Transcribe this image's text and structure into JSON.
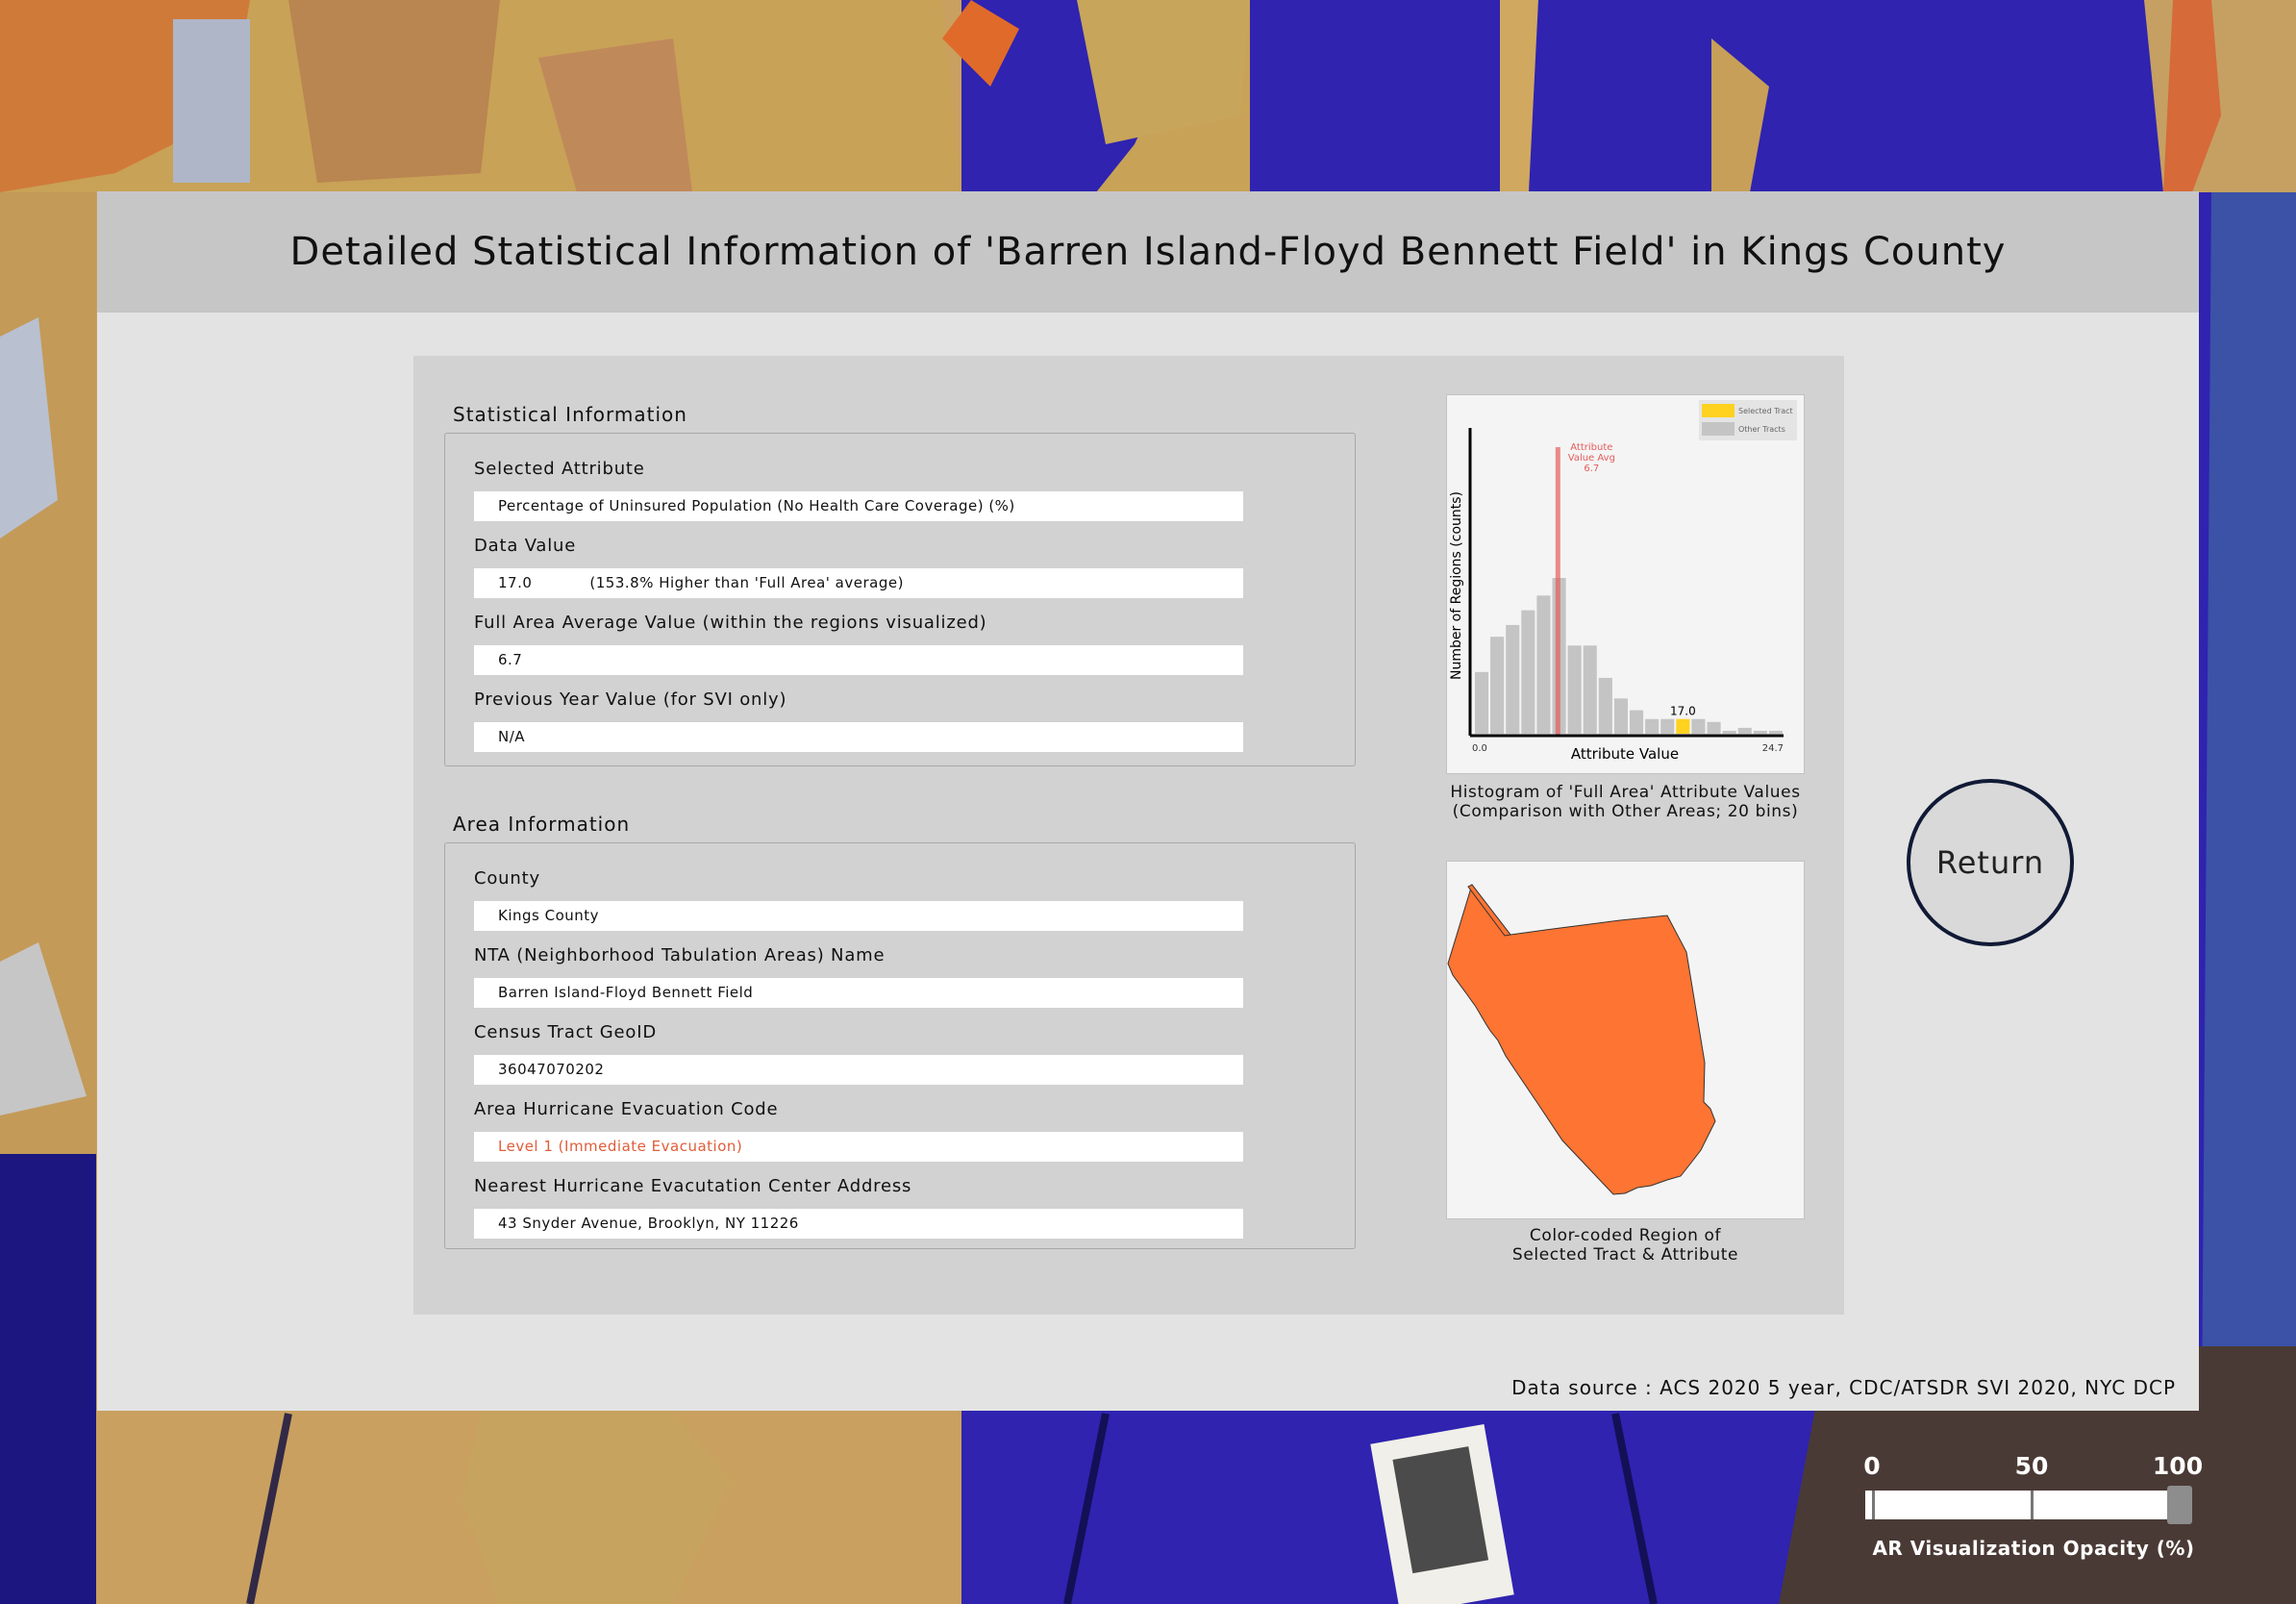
{
  "title": "Detailed Statistical Information of 'Barren Island-Floyd Bennett Field' in Kings County",
  "statistical": {
    "heading": "Statistical Information",
    "selected_attribute_label": "Selected Attribute",
    "selected_attribute_value": "Percentage of Uninsured Population (No Health Care Coverage) (%)",
    "data_value_label": "Data Value",
    "data_value": "17.0",
    "data_value_note": "(153.8% Higher than 'Full Area' average)",
    "full_avg_label": "Full Area Average Value (within the regions visualized)",
    "full_avg_value": "6.7",
    "prev_year_label": "Previous Year Value (for SVI only)",
    "prev_year_value": "N/A"
  },
  "area": {
    "heading": "Area Information",
    "county_label": "County",
    "county_value": "Kings County",
    "nta_label": "NTA (Neighborhood Tabulation Areas) Name",
    "nta_value": "Barren Island-Floyd Bennett Field",
    "geoid_label": "Census Tract GeoID",
    "geoid_value": "36047070202",
    "evac_label": "Area Hurricane Evacuation Code",
    "evac_value": "Level 1 (Immediate Evacuation)",
    "center_label": "Nearest Hurricane Evacutation Center Address",
    "center_value": "43 Snyder Avenue, Brooklyn, NY 11226"
  },
  "histogram": {
    "caption_line1": "Histogram of 'Full Area' Attribute Values",
    "caption_line2": "(Comparison with Other Areas; 20 bins)",
    "ylabel": "Number of Regions (counts)",
    "xlabel": "Attribute Value",
    "xmin_label": "0.0",
    "xmax_label": "24.7",
    "avg_line1": "Attribute",
    "avg_line2": "Value Avg",
    "avg_line3": "6.7",
    "selected_label": "17.0",
    "legend_selected": "Selected Tract",
    "legend_other": "Other Tracts"
  },
  "chart_data": {
    "type": "bar",
    "x_range": [
      0.0,
      24.7
    ],
    "bins": 20,
    "counts": [
      21,
      33,
      37,
      42,
      47,
      53,
      30,
      30,
      19,
      12,
      8,
      5,
      5,
      5,
      5,
      4,
      1,
      2,
      1,
      1
    ],
    "selected_bin": 13,
    "average": 6.7,
    "selected_value": 17.0,
    "xlabel": "Attribute Value",
    "ylabel": "Number of Regions (counts)",
    "legend": [
      "Selected Tract",
      "Other Tracts"
    ],
    "legend_position": "top-right",
    "colors": {
      "selected": "#ffd21f",
      "other": "#c4c4c4",
      "avg_line": "#e65b5b"
    }
  },
  "region_map": {
    "caption_line1": "Color-coded Region of",
    "caption_line2": "Selected Tract & Attribute",
    "fill_color": "#fd7433"
  },
  "return_label": "Return",
  "source": "Data source : ACS 2020 5 year, CDC/ATSDR SVI 2020, NYC DCP",
  "opacity_slider": {
    "tick0": "0",
    "tick50": "50",
    "tick100": "100",
    "caption": "AR Visualization Opacity (%)",
    "value": 100
  }
}
